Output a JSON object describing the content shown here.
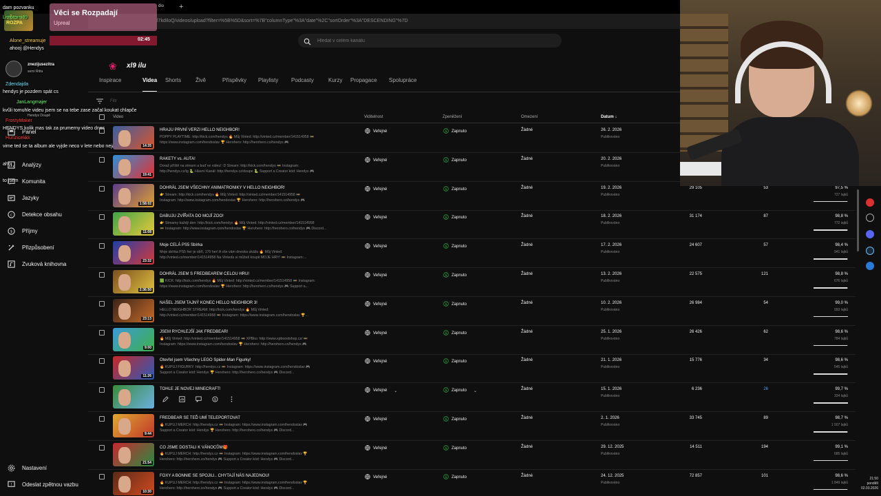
{
  "browser": {
    "url": "l7kdIloQ/videos/upload?filter=%5B%5D&sort=%7B\"columnType\"%3A\"date\"%2C\"sortOrder\"%3A\"DESCENDING\"%7D",
    "tab_fragment": "dio"
  },
  "search": {
    "placeholder": "Hledat v celém kanálu"
  },
  "tabs": [
    {
      "label": "Inspirace",
      "active": false
    },
    {
      "label": "Videa",
      "active": true
    },
    {
      "label": "Shorts",
      "active": false
    },
    {
      "label": "Živě",
      "active": false
    },
    {
      "label": "Příspěvky",
      "active": false
    },
    {
      "label": "Playlisty",
      "active": false
    },
    {
      "label": "Podcasty",
      "active": false
    },
    {
      "label": "Kurzy",
      "active": false
    },
    {
      "label": "Propagace",
      "active": false
    },
    {
      "label": "Spolupráce",
      "active": false
    }
  ],
  "filter": {
    "label": "Filtr"
  },
  "columns": {
    "video": "Video",
    "visibility": "Viditelnost",
    "monetization": "Zpeněžení",
    "restrictions": "Omezení",
    "date": "Datum"
  },
  "sidebar": {
    "items": [
      {
        "label": "Panel",
        "icon": "dashboard-icon"
      },
      {
        "label": "Analýzy",
        "icon": "analytics-icon"
      },
      {
        "label": "Komunita",
        "icon": "community-icon"
      },
      {
        "label": "Jazyky",
        "icon": "languages-icon"
      },
      {
        "label": "Detekce obsahu",
        "icon": "copyright-icon"
      },
      {
        "label": "Příjmy",
        "icon": "earn-icon"
      },
      {
        "label": "Přizpůsobení",
        "icon": "customization-icon"
      },
      {
        "label": "Zvuková knihovna",
        "icon": "audio-library-icon"
      }
    ],
    "bottom": [
      {
        "label": "Nastavení",
        "icon": "gear-icon"
      },
      {
        "label": "Odeslat zpětnou vazbu",
        "icon": "feedback-icon"
      }
    ]
  },
  "chat": {
    "lines": [
      {
        "user": "",
        "text": "dam pozvanku"
      },
      {
        "user": "Limotomi89",
        "text": ""
      },
      {
        "user": "Alone_streamuje",
        "text": ""
      },
      {
        "user": "",
        "text": "ahooj @Hendys"
      },
      {
        "user": "znezijusezitra",
        "text": ""
      },
      {
        "user": "",
        "text": "semi Ritta"
      },
      {
        "user": "",
        "text": "hendys je pozdem spát cs"
      },
      {
        "user": "Zdendajda",
        "text": ""
      },
      {
        "user": "JanLangmajer",
        "text": ""
      },
      {
        "user": "",
        "text": "kvůli tomuhle videu jsem se na tebe zase začal koukat chlapče"
      },
      {
        "user": "",
        "text": "Hendys Doupě"
      },
      {
        "user": "FrostyMaker",
        "text": ""
      },
      {
        "user": "",
        "text": "HENDYS kolik mas tak za prumerny video dnes"
      },
      {
        "user": "Hunzicekkk",
        "text": ""
      },
      {
        "user": "",
        "text": "vime ted se ta album ale vyjde neco v lete nebo nejaky single"
      },
      {
        "user": "",
        "text": "ahoj"
      },
      {
        "user": "",
        "text": "to jsem"
      }
    ],
    "alert": {
      "title": "Věci se Rozpadají",
      "subtitle": "Upreal",
      "avatar_text": "VĚCI SE ROZPA"
    },
    "timer": "02:45",
    "badge": "xl9 ilu"
  },
  "videos": [
    {
      "title": "HRAJU PRVNÍ VERZI HELLO NEIGHBOR!",
      "desc1": "POPPY PLAYTIME: http://kick.com/hendys 🔥 Můj Vinted: http://vinted.cz/member/141514958 🚥",
      "desc2": "https://www.instagram.com/hendoslav 🏆 Herohero: http://herohero.co/hendys 🎮",
      "duration": "14:35",
      "visibility": "Veřejné",
      "monetization": "Zapnuto",
      "restrictions": "Žádné",
      "date": "26. 2. 2026",
      "date_sub": "Publikováno",
      "views": "",
      "comments": "",
      "likes": "",
      "likes_sub": "",
      "like_fraction": 0,
      "thumb": [
        "#3a5fa0",
        "#d9552b"
      ]
    },
    {
      "title": "RAKETY vs. AUTA!",
      "desc1": "Doraž příště na stream a buď ve videu! :D Stream: http://kick.com/hendys 🚥 Instagram:",
      "desc2": "http://hendys.cz/ig 🐍 Hlavní Kanál: http://hendys.cz/doupe 🐍 Support a Creator kód: Hendys 🎮",
      "duration": "19:41",
      "visibility": "Veřejné",
      "monetization": "Zapnuto",
      "restrictions": "Žádné",
      "date": "20. 2. 2026",
      "date_sub": "Publikováno",
      "views": "",
      "comments": "",
      "likes": "",
      "likes_sub": "",
      "like_fraction": 0,
      "thumb": [
        "#2e8fd6",
        "#e53030"
      ]
    },
    {
      "title": "DOHRÁL JSEM VŠECHNY ANIMATRONIKY V HELLO NEIGHBOR!",
      "desc1": "👉 Stream: http://kick.com/hendys 🔥 Můj Vinted: http://vinted.cz/member/141514958 🚥",
      "desc2": "Instagram: http://www.instagram.com/hendoslav 🏆 Herohero: http://herohero.co/hendys 🎮",
      "duration": "1:58:02",
      "visibility": "Veřejné",
      "monetization": "Zapnuto",
      "restrictions": "Žádné",
      "date": "19. 2. 2026",
      "date_sub": "Publikováno",
      "views": "29 105",
      "comments": "53",
      "likes": "97,5 %",
      "likes_sub": "727 lajků",
      "like_fraction": 0.975,
      "thumb": [
        "#5a3d8a",
        "#e0a030"
      ]
    },
    {
      "title": "DABUJU ZVÍŘATA DO MOJÍ ZOO!",
      "desc1": "👉 Streamy každý den: http://kick.com/hendys 🔥 Můj Vinted: http://vinted.cz/member/141514958",
      "desc2": "🚥 Instagram: http://www.instagram.com/hendoslav 🏆 Herohero: http://herohero.co/hendys 🎮 Discord...",
      "duration": "11:08",
      "visibility": "Veřejné",
      "monetization": "Zapnuto",
      "restrictions": "Žádné",
      "date": "18. 2. 2026",
      "date_sub": "Publikováno",
      "views": "31 174",
      "comments": "87",
      "likes": "98,8 %",
      "likes_sub": "772 lajků",
      "like_fraction": 0.988,
      "thumb": [
        "#3fa34a",
        "#e8c93a"
      ]
    },
    {
      "title": "Moje CELÁ PS5 Sbírka",
      "desc1": "Moje sbírka PS5 her je obří, 170 her! A vše vám dneska ukážu 🔥 Můj Vinted:",
      "desc2": "http://vinted.cz/member/141514958 Na Vintedu si můžeš koupit MOJE HRY! 🚥 Instagram:...",
      "duration": "23:32",
      "visibility": "Veřejné",
      "monetization": "Zapnuto",
      "restrictions": "Žádné",
      "date": "17. 2. 2026",
      "date_sub": "Publikováno",
      "views": "24 607",
      "comments": "57",
      "likes": "98,4 %",
      "likes_sub": "941 lajků",
      "like_fraction": 0.984,
      "thumb": [
        "#1f3fa8",
        "#d53a3a"
      ]
    },
    {
      "title": "DOHRÁL JSEM S FREDBEAREM CELOU HRU!",
      "desc1": "🟩 KICK: http://kick.com/hendys 🔥 Můj Vinted: http://vinted.cz/member/141514958 🚥 Instagram:",
      "desc2": "https://www.instagram.com/hendoslav 🏆 Herohero: http://herohero.co/hendys 🎮 Support a...",
      "duration": "2:36:50",
      "visibility": "Veřejné",
      "monetization": "Zapnuto",
      "restrictions": "Žádné",
      "date": "13. 2. 2026",
      "date_sub": "Publikováno",
      "views": "22 575",
      "comments": "121",
      "likes": "98,8 %",
      "likes_sub": "676 lajků",
      "like_fraction": 0.988,
      "thumb": [
        "#7a5020",
        "#e0c040"
      ]
    },
    {
      "title": "NAŠEL JSEM TAJNÝ KONEC HELLO NEIGHBOR 3!",
      "desc1": "HELLO NEIGHBOR STREAM: http://kick.com/hendys 🔥 Můj Vinted:",
      "desc2": "http://vinted.cz/member/141514958 🚥 Instagram: https://www.instagram.com/hendoslav 🏆...",
      "duration": "23:13",
      "visibility": "Veřejné",
      "monetization": "Zapnuto",
      "restrictions": "Žádné",
      "date": "10. 2. 2026",
      "date_sub": "Publikováno",
      "views": "26 984",
      "comments": "54",
      "likes": "99,0 %",
      "likes_sub": "993 lajků",
      "like_fraction": 0.99,
      "thumb": [
        "#3a2418",
        "#c46a28"
      ]
    },
    {
      "title": "JSEM RYCHLEJŠÍ JAK FREDBEAR!",
      "desc1": "🔥 Můj Vinted: http://vinted.cz/member/141514958 🚥 XPBko: http://www.xpboostshop.cz/ 🚥",
      "desc2": "Instagram: https://www.instagram.com/hendoslav 🏆 Herohero: http://herohero.co/hendys 🎮",
      "duration": "9:00",
      "visibility": "Veřejné",
      "monetization": "Zapnuto",
      "restrictions": "Žádné",
      "date": "25. 1. 2026",
      "date_sub": "Publikováno",
      "views": "26 426",
      "comments": "62",
      "likes": "98,6 %",
      "likes_sub": "784 lajků",
      "like_fraction": 0.986,
      "thumb": [
        "#3a9ad8",
        "#3fb04a"
      ]
    },
    {
      "title": "Otevřel jsem Všechny LEGO Spider-Man Figurky!",
      "desc1": "🔥 KUPUJ FIGURKY: http://hendys.cz 🚥 Instagram: https://www.instagram.com/hendoslav 🎮",
      "desc2": "Support a Creator kód: Hendys 🏆 Herohero: http://herohero.co/hendys 🎮 Discord...",
      "duration": "11:26",
      "visibility": "Veřejné",
      "monetization": "Zapnuto",
      "restrictions": "Žádné",
      "date": "21. 1. 2026",
      "date_sub": "Publikováno",
      "views": "15 776",
      "comments": "34",
      "likes": "98,6 %",
      "likes_sub": "545 lajků",
      "like_fraction": 0.986,
      "thumb": [
        "#c82828",
        "#2a5ab8"
      ]
    },
    {
      "title": "TOHLE JE NOVEJ MINECRAFT!",
      "desc1": "",
      "desc2": "",
      "duration": "",
      "visibility": "Veřejné",
      "monetization": "Zapnuto",
      "restrictions": "Žádné",
      "date": "15. 1. 2026",
      "date_sub": "Publikováno",
      "views": "6 236",
      "comments": "26",
      "likes": "99,7 %",
      "likes_sub": "334 lajků",
      "like_fraction": 0.997,
      "thumb": [
        "#3a8a3a",
        "#6ab0e0"
      ],
      "hovered": true
    },
    {
      "title": "FREDBEAR SE TEĎ UMÍ TELEPORTOVAT",
      "desc1": "🔥 KUPUJ MERCH: http://hendys.cz 🚥 Instagram: https://www.instagram.com/hendoslav 🎮",
      "desc2": "Support a Creator kód: Hendys 🏆 Herohero: http://herohero.co/hendys 🎮 Discord...",
      "duration": "9:44",
      "visibility": "Veřejné",
      "monetization": "Zapnuto",
      "restrictions": "Žádné",
      "date": "2. 1. 2026",
      "date_sub": "Publikováno",
      "views": "33 745",
      "comments": "89",
      "likes": "98,7 %",
      "likes_sub": "1 507 lajků",
      "like_fraction": 0.987,
      "thumb": [
        "#e0a830",
        "#c0382a"
      ]
    },
    {
      "title": "CO JSME DOSTALI K VÁNOCŮM🎁",
      "desc1": "🔥 KUPUJ MERCH: http://hendys.cz 🚥 Instagram: https://www.instagram.com/hendoslav 🏆",
      "desc2": "Herohero: http://herohero.co/hendys 🎮 Support a Creator kód: Hendys 🎮 Discord...",
      "duration": "21:54",
      "visibility": "Veřejné",
      "monetization": "Zapnuto",
      "restrictions": "Žádné",
      "date": "29. 12. 2025",
      "date_sub": "Publikováno",
      "views": "14 511",
      "comments": "194",
      "likes": "99,1 %",
      "likes_sub": "685 lajků",
      "like_fraction": 0.991,
      "thumb": [
        "#c82830",
        "#2a8a40"
      ]
    },
    {
      "title": "FOXY A BONNIE SE SPOJILI.. CHYTAJÍ NÁS NAJEDNOU!",
      "desc1": "🔥 KUPUJ MERCH: http://hendys.cz 🚥 Instagram: https://www.instagram.com/hendoslav 🏆",
      "desc2": "Herohero: http://herohero.co/hendys 🎮 Support a Creator kód: Hendys 🎮 Discord...",
      "duration": "10:30",
      "visibility": "Veřejné",
      "monetization": "Zapnuto",
      "restrictions": "Žádné",
      "date": "24. 12. 2025",
      "date_sub": "Publikováno",
      "views": "72 857",
      "comments": "101",
      "likes": "98,6 %",
      "likes_sub": "1 849 lajků",
      "like_fraction": 0.986,
      "thumb": [
        "#5a2a18",
        "#d04a20"
      ]
    }
  ],
  "clock": {
    "time": "21:50",
    "day": "pondělí",
    "date": "02.03.2026"
  },
  "colors": {
    "bg": "#0f0f0f",
    "accent_link": "#3ea6ff",
    "monetization_green": "#2ba640"
  }
}
